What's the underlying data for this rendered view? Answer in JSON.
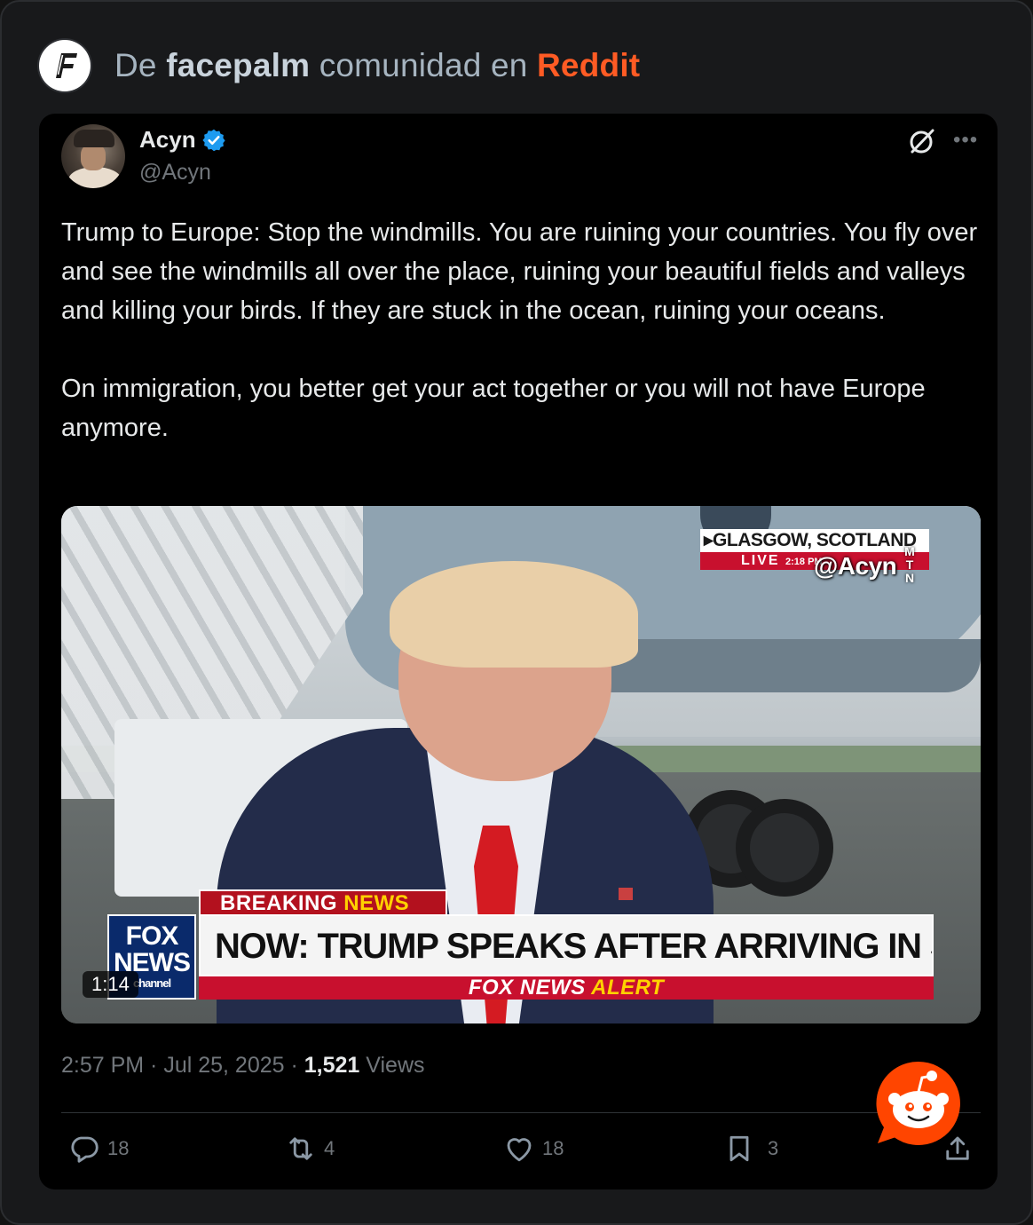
{
  "header": {
    "prefix": "De",
    "subreddit": "facepalm",
    "middle": "comunidad en",
    "brand": "Reddit",
    "logo_letter": "F"
  },
  "tweet": {
    "author_name": "Acyn",
    "author_handle": "@Acyn",
    "verified": true,
    "paragraphs": [
      "Trump to Europe: Stop the windmills. You are ruining your countries. You fly over and see the windmills all over the place, ruining your beautiful fields and valleys and killing your birds. If they are stuck in the ocean, ruining your oceans.",
      "On immigration, you better get your act together or you will not have Europe anymore."
    ],
    "video": {
      "location": "▸GLASGOW, SCOTLAND",
      "live": "LIVE",
      "live_time": "2:18 PM",
      "watermark": "@Acyn",
      "watermark_side": [
        "M",
        "T",
        "N"
      ],
      "breaking_white": "BREAKING",
      "breaking_yellow": "NEWS",
      "fox_logo_line1": "FOX",
      "fox_logo_line2": "NEWS",
      "fox_logo_line3": "channel",
      "headline": "NOW: TRUMP SPEAKS AFTER ARRIVING IN SCOTLAND",
      "alert_white": "FOX NEWS",
      "alert_yellow": "ALERT",
      "duration": "1:14"
    },
    "timestamp": "2:57 PM · Jul 25, 2025 · ",
    "views_count": "1,521",
    "views_label": " Views",
    "actions": {
      "replies": "18",
      "reposts": "4",
      "likes": "18",
      "bookmarks": "3"
    }
  },
  "icons": {
    "verified": "verified-badge-icon",
    "grok": "grok-icon",
    "more": "more-icon",
    "reply": "reply-icon",
    "repost": "repost-icon",
    "like": "heart-icon",
    "bookmark": "bookmark-icon",
    "share": "share-icon",
    "reddit": "reddit-snoo-icon"
  },
  "colors": {
    "reddit_orange": "#ff5b24",
    "verified_blue": "#1d9bf0",
    "muted": "#71767b"
  }
}
